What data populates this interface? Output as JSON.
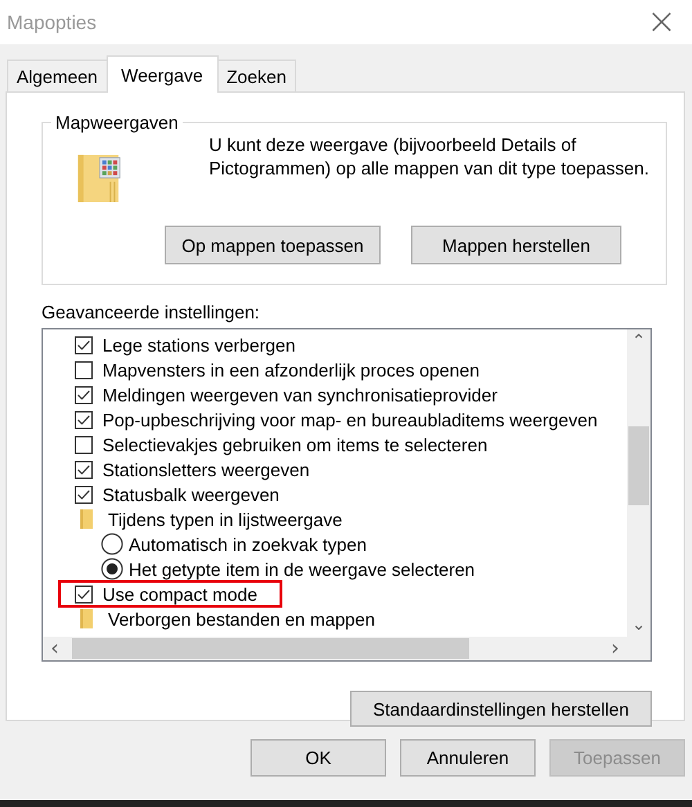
{
  "window": {
    "title": "Mapopties",
    "close": "×"
  },
  "tabs": [
    {
      "label": "Algemeen",
      "selected": false
    },
    {
      "label": "Weergave",
      "selected": true
    },
    {
      "label": "Zoeken",
      "selected": false
    }
  ],
  "folder_views": {
    "title": "Mapweergaven",
    "description": "U kunt deze weergave (bijvoorbeeld Details of Pictogrammen) op alle mappen van dit type toepassen.",
    "buttons": [
      "Op mappen toepassen",
      "Mappen herstellen"
    ]
  },
  "advanced": {
    "label": "Geavanceerde instellingen:",
    "items": [
      {
        "kind": "checkbox",
        "label": "Lege stations verbergen",
        "checked": true,
        "highlighted": false
      },
      {
        "kind": "checkbox",
        "label": "Mapvensters in een afzonderlijk proces openen",
        "checked": false,
        "highlighted": false
      },
      {
        "kind": "checkbox",
        "label": "Meldingen weergeven van synchronisatieprovider",
        "checked": true,
        "highlighted": false
      },
      {
        "kind": "checkbox",
        "label": "Pop-upbeschrijving voor map- en bureaubladitems weergeven",
        "checked": true,
        "highlighted": false
      },
      {
        "kind": "checkbox",
        "label": "Selectievakjes gebruiken om items te selecteren",
        "checked": false,
        "highlighted": false
      },
      {
        "kind": "checkbox",
        "label": "Stationsletters weergeven",
        "checked": true,
        "highlighted": false
      },
      {
        "kind": "checkbox",
        "label": "Statusbalk weergeven",
        "checked": true,
        "highlighted": false
      },
      {
        "kind": "folder",
        "label": "Tijdens typen in lijstweergave",
        "children": [
          {
            "kind": "radio",
            "label": "Automatisch in zoekvak typen",
            "selected": false
          },
          {
            "kind": "radio",
            "label": "Het getypte item in de weergave selecteren",
            "selected": true
          }
        ]
      },
      {
        "kind": "checkbox",
        "label": "Use compact mode",
        "checked": true,
        "highlighted": true
      },
      {
        "kind": "folder",
        "label": "Verborgen bestanden en mappen"
      }
    ],
    "scroll_up": "⌃",
    "scroll_down": "⌄",
    "scroll_left": "‹",
    "scroll_right": "›"
  },
  "restore_button": "Standaardinstellingen herstellen",
  "footer": [
    {
      "label": "OK",
      "disabled": false
    },
    {
      "label": "Annuleren",
      "disabled": false
    },
    {
      "label": "Toepassen",
      "disabled": true
    }
  ]
}
